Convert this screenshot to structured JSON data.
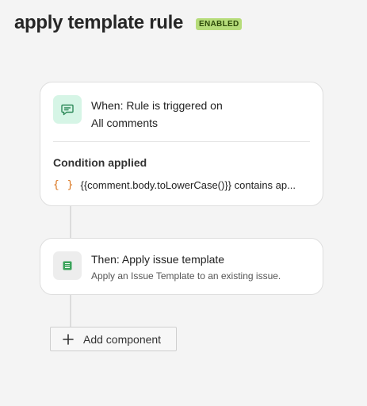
{
  "header": {
    "title": "apply template rule",
    "status_badge": "ENABLED"
  },
  "trigger": {
    "icon": "comment-icon",
    "line1": "When: Rule is triggered on",
    "line2": "All comments",
    "condition_heading": "Condition applied",
    "condition_icon": "{ }",
    "condition_text": "{{comment.body.toLowerCase()}} contains ap..."
  },
  "action": {
    "icon": "template-icon",
    "title": "Then: Apply issue template",
    "description": "Apply an Issue Template to an existing issue."
  },
  "add_component": {
    "label": "Add component"
  },
  "colors": {
    "badge_bg": "#b6dc7a",
    "trigger_icon_bg": "#d6f5e6",
    "condition_icon": "#d9731b",
    "template_icon": "#3aa35a"
  }
}
